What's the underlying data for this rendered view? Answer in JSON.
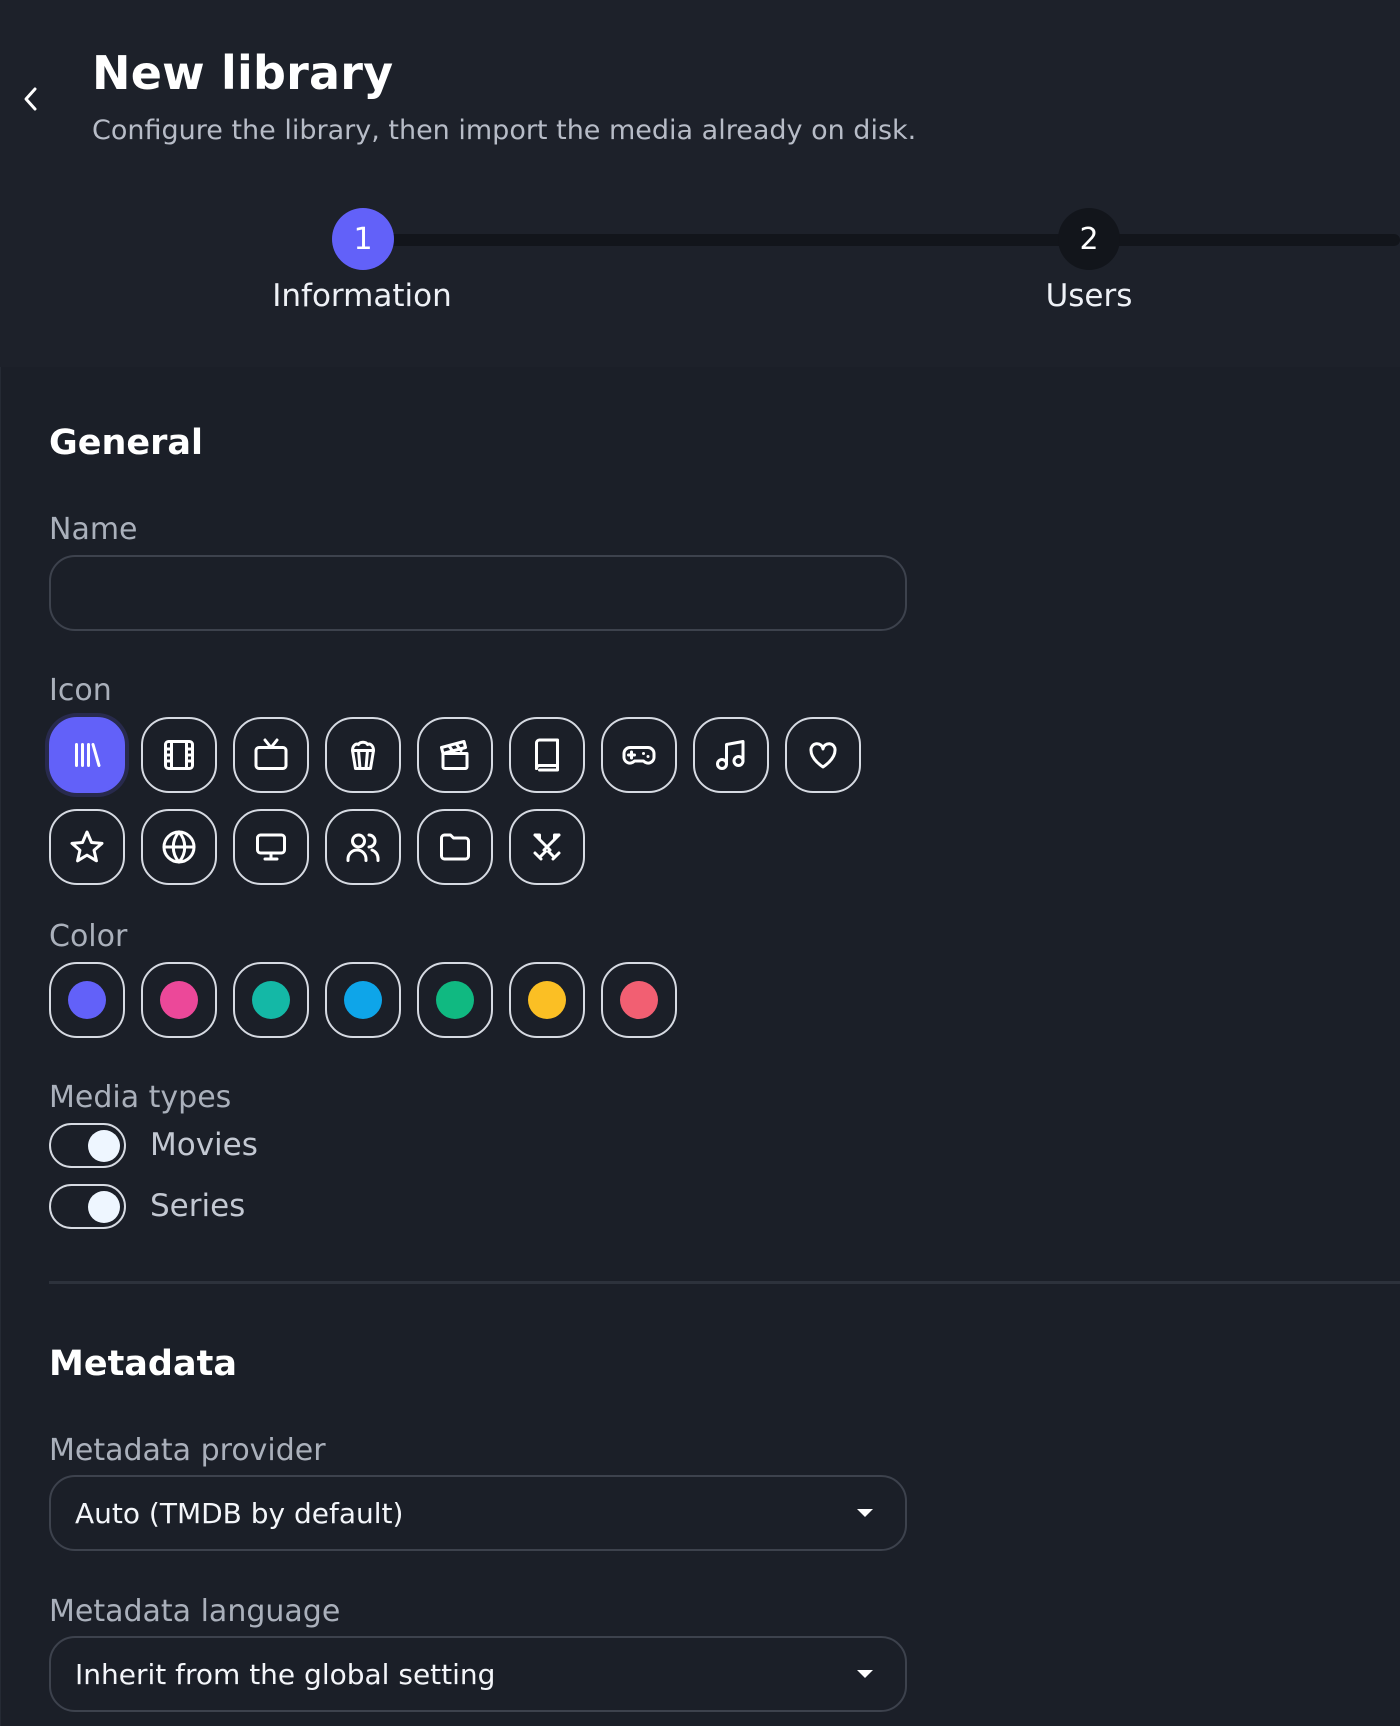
{
  "header": {
    "title": "New library",
    "subtitle": "Configure the library, then import the media already on disk."
  },
  "stepper": {
    "steps": [
      {
        "number": "1",
        "label": "Information",
        "state": "active"
      },
      {
        "number": "2",
        "label": "Users",
        "state": "inactive"
      }
    ]
  },
  "general": {
    "title": "General",
    "name_label": "Name",
    "name_value": "",
    "icon_label": "Icon",
    "icons": [
      {
        "name": "library-icon",
        "selected": true
      },
      {
        "name": "film-icon"
      },
      {
        "name": "tv-icon"
      },
      {
        "name": "popcorn-icon"
      },
      {
        "name": "clapperboard-icon"
      },
      {
        "name": "book-icon"
      },
      {
        "name": "gamepad-icon"
      },
      {
        "name": "music-icon"
      },
      {
        "name": "heart-icon"
      },
      {
        "name": "star-icon"
      },
      {
        "name": "globe-icon"
      },
      {
        "name": "monitor-icon"
      },
      {
        "name": "users-icon"
      },
      {
        "name": "folder-icon"
      },
      {
        "name": "swords-icon"
      }
    ],
    "color_label": "Color",
    "colors": [
      "#6261f9",
      "#ec4899",
      "#14b8a6",
      "#0ea5e9",
      "#10b981",
      "#fbbf24",
      "#f25f72"
    ],
    "media_types_label": "Media types",
    "media_types": [
      {
        "label": "Movies",
        "enabled": true
      },
      {
        "label": "Series",
        "enabled": true
      }
    ]
  },
  "metadata": {
    "title": "Metadata",
    "provider_label": "Metadata provider",
    "provider_value": "Auto (TMDB by default)",
    "language_label": "Metadata language",
    "language_value": "Inherit from the global setting"
  },
  "theme": {
    "accent": "#6261f9",
    "background": "#1b1f28"
  }
}
